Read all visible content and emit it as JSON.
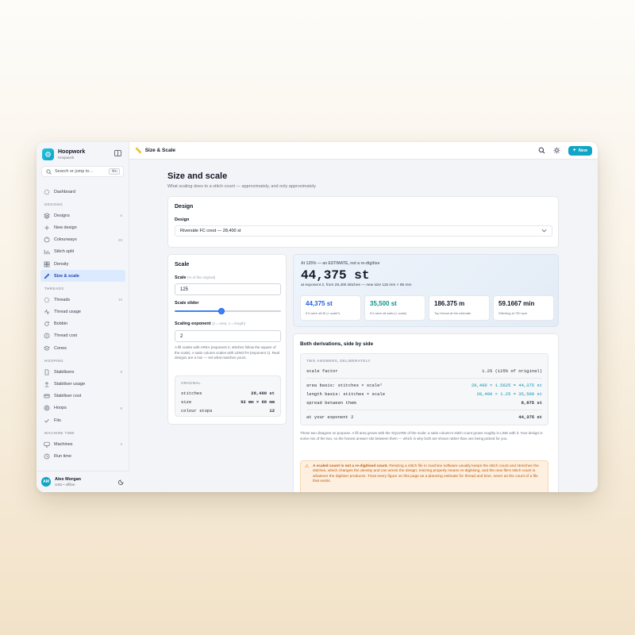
{
  "app": {
    "name": "Hoopwork",
    "workspace": "Hoopwork"
  },
  "search": {
    "placeholder": "Search or jump to…",
    "shortcut": "⌘K"
  },
  "nav": {
    "dashboard": "Dashboard",
    "sections": [
      {
        "title": "DESIGNS",
        "items": [
          {
            "label": "Designs",
            "count": "6",
            "icon": "layers-icon"
          },
          {
            "label": "New design",
            "icon": "plus-icon"
          },
          {
            "label": "Colourways",
            "count": "29",
            "icon": "palette-icon"
          },
          {
            "label": "Stitch split",
            "icon": "bar-chart-icon"
          },
          {
            "label": "Density",
            "icon": "grid-icon"
          },
          {
            "label": "Size & scale",
            "icon": "ruler-icon",
            "active": true
          }
        ]
      },
      {
        "title": "THREADS",
        "items": [
          {
            "label": "Threads",
            "count": "10",
            "icon": "spool-icon"
          },
          {
            "label": "Thread usage",
            "icon": "activity-icon"
          },
          {
            "label": "Bobbin",
            "icon": "refresh-icon"
          },
          {
            "label": "Thread cost",
            "icon": "coin-icon"
          },
          {
            "label": "Cones",
            "icon": "stack-icon"
          }
        ]
      },
      {
        "title": "HOOPING",
        "items": [
          {
            "label": "Stabilisers",
            "count": "5",
            "icon": "file-icon"
          },
          {
            "label": "Stabiliser usage",
            "icon": "upload-icon"
          },
          {
            "label": "Stabiliser cost",
            "icon": "card-icon"
          },
          {
            "label": "Hoops",
            "count": "6",
            "icon": "target-icon"
          },
          {
            "label": "Fits",
            "icon": "check-icon"
          }
        ]
      },
      {
        "title": "MACHINE TIME",
        "items": [
          {
            "label": "Machines",
            "count": "3",
            "icon": "monitor-icon"
          },
          {
            "label": "Run time",
            "icon": "clock-icon"
          }
        ]
      }
    ]
  },
  "user": {
    "initials": "AM",
    "name": "Alex Morgan",
    "meta": "USD • offline"
  },
  "topbar": {
    "title": "Size & Scale",
    "new_label": "New"
  },
  "page": {
    "title": "Size and scale",
    "subtitle": "What scaling does to a stitch count — approximately, and only approximately"
  },
  "design": {
    "title": "Design",
    "label": "Design",
    "selected": "Riverside FC crest — 28,400 st"
  },
  "scale": {
    "title": "Scale",
    "scale_label": "Scale",
    "scale_hint": "(% of the original)",
    "scale_value": "125",
    "slider_label": "Scale slider",
    "slider_fraction": 0.44,
    "exponent_label": "Scaling exponent",
    "exponent_hint": "(2 = area, 1 = length)",
    "exponent_value": "2",
    "help": "A fill scales with AREA (exponent 2, stitches follow the square of the scale). A satin column scales with LENGTH (exponent 1). Real designs are a mix — set what matches yours.",
    "original": {
      "heading": "ORIGINAL",
      "rows": [
        {
          "k": "stitches",
          "v": "28,400 st"
        },
        {
          "k": "size",
          "v": "92 mm × 68 mm"
        },
        {
          "k": "colour stops",
          "v": "12"
        }
      ]
    }
  },
  "estimate": {
    "tag": "At 125% — an ESTIMATE, not a re-digitise",
    "value": "44,375 st",
    "note": "at exponent 2, from 28,400 stitches — new size 115 mm × 85 mm",
    "stats": [
      {
        "value": "44,375 st",
        "label": "If it were all fill (× scale²)",
        "color": "#2563eb"
      },
      {
        "value": "35,500 st",
        "label": "If it were all satin (× scale)",
        "color": "#0d9488"
      },
      {
        "value": "186.375 m",
        "label": "Top thread at the estimate",
        "color": "#111827"
      },
      {
        "value": "59.1667 min",
        "label": "Stitching at 750 spm",
        "color": "#111827"
      }
    ]
  },
  "derivations": {
    "title": "Both derivations, side by side",
    "heading": "TWO ANSWERS, DELIBERATELY",
    "scale_factor_k": "scale factor",
    "scale_factor_v": "1.25 (125% of original)",
    "area_k": "area basis: stitches × scale²",
    "area_v": "28,400 × 1.5625 = 44,375 st",
    "length_k": "length basis: stitches × scale",
    "length_v": "28,400 × 1.25 = 35,500 st",
    "spread_k": "spread between them",
    "spread_v": "8,875 st",
    "exp_k": "at your exponent 2",
    "exp_v": "44,375 st",
    "para": "These two disagree on purpose. A fill area grows with the SQUARE of the scale; a satin column's stitch count grows roughly in LINE with it. Your design is some mix of the two, so the honest answer sits between them — which is why both are shown rather than one being picked for you.",
    "warn_bold": "A scaled count is not a re-digitised count.",
    "warn_text": " Resizing a stitch file in machine software usually keeps the stitch count and stretches the stitches, which changes the density and can wreck the design; resizing properly means re-digitising, and the new file's stitch count is whatever the digitiser produces. Treat every figure on this page as a planning estimate for thread and time, never as the count of a file that exists."
  }
}
